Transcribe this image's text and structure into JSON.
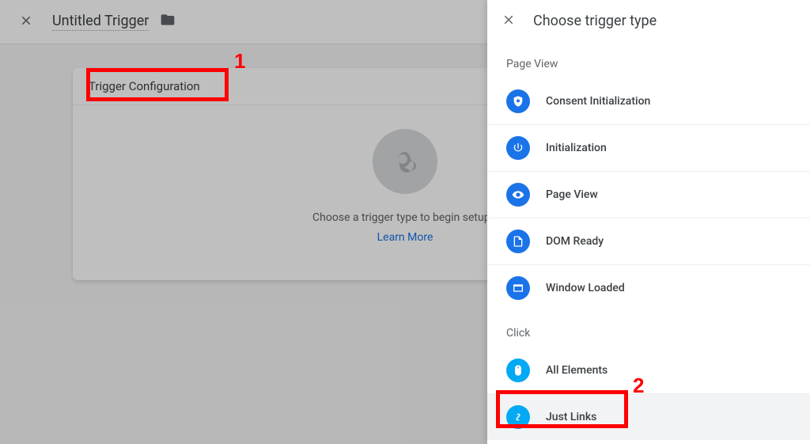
{
  "header": {
    "title": "Untitled Trigger"
  },
  "card": {
    "header": "Trigger Configuration",
    "prompt": "Choose a trigger type to begin setup…",
    "learn": "Learn More"
  },
  "panel": {
    "title": "Choose trigger type",
    "sections": [
      {
        "title": "Page View",
        "items": [
          {
            "label": "Consent Initialization",
            "icon": "shield"
          },
          {
            "label": "Initialization",
            "icon": "power"
          },
          {
            "label": "Page View",
            "icon": "eye"
          },
          {
            "label": "DOM Ready",
            "icon": "document"
          },
          {
            "label": "Window Loaded",
            "icon": "window"
          }
        ]
      },
      {
        "title": "Click",
        "items": [
          {
            "label": "All Elements",
            "icon": "mouse"
          },
          {
            "label": "Just Links",
            "icon": "link"
          }
        ]
      }
    ]
  },
  "annotations": {
    "a1": "1",
    "a2": "2"
  }
}
